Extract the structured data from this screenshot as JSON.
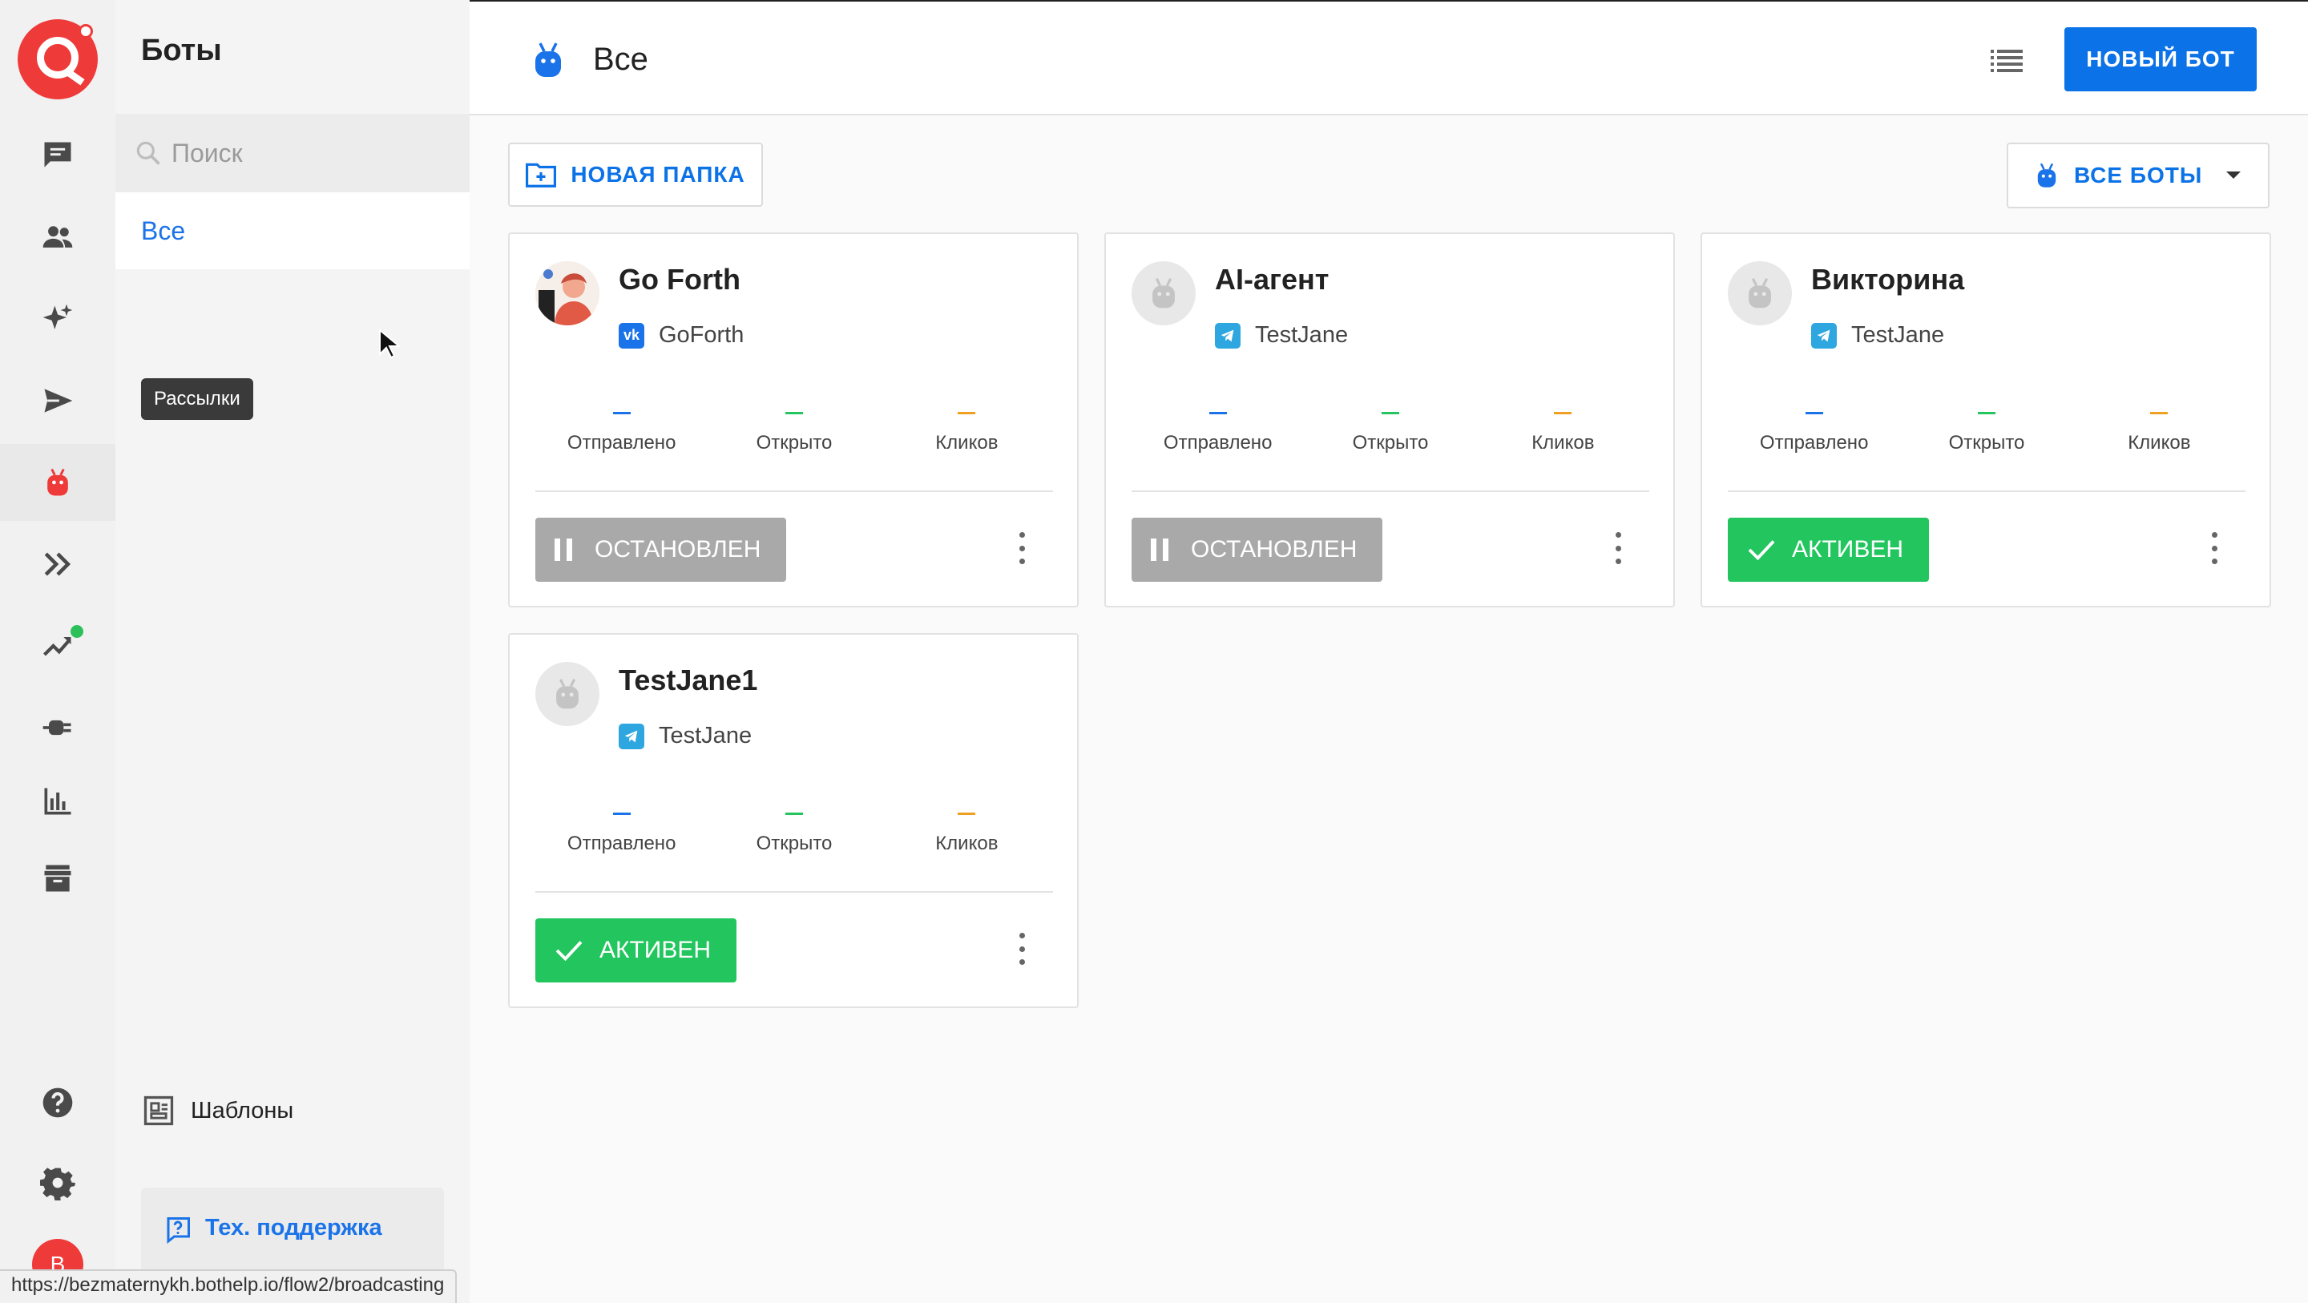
{
  "sidebar": {
    "title": "Боты",
    "search_placeholder": "Поиск",
    "folder_all": "Все",
    "templates_label": "Шаблоны",
    "support_label": "Тех. поддержка"
  },
  "rail": {
    "avatar_letter": "B",
    "tooltip": "Рассылки"
  },
  "header": {
    "title": "Все",
    "new_bot_label": "НОВЫЙ БОТ"
  },
  "toolbar": {
    "new_folder_label": "НОВАЯ ПАПКА",
    "filter_label": "ВСЕ БОТЫ"
  },
  "cards": [
    {
      "name": "Go Forth",
      "channel": "GoForth",
      "channel_type": "vk",
      "sent": "–",
      "opened": "–",
      "clicks": "–",
      "status": "ОСТАНОВЛЕН",
      "state": "stopped"
    },
    {
      "name": "AI-агент",
      "channel": "TestJane",
      "channel_type": "telegram",
      "sent": "–",
      "opened": "–",
      "clicks": "–",
      "status": "ОСТАНОВЛЕН",
      "state": "stopped"
    },
    {
      "name": "Викторина",
      "channel": "TestJane",
      "channel_type": "telegram",
      "sent": "–",
      "opened": "–",
      "clicks": "–",
      "status": "АКТИВЕН",
      "state": "active"
    },
    {
      "name": "TestJane1",
      "channel": "TestJane",
      "channel_type": "telegram",
      "sent": "–",
      "opened": "–",
      "clicks": "–",
      "status": "АКТИВЕН",
      "state": "active"
    }
  ],
  "stat_labels": {
    "sent": "Отправлено",
    "opened": "Открыто",
    "clicks": "Кликов"
  },
  "colors": {
    "accent": "#0b72e7",
    "brand": "#ef3a3a",
    "active": "#22c55e",
    "stopped": "#a9a9a9",
    "sent_dash": "#1a73e8",
    "opened_dash": "#22c55e",
    "clicks_dash": "#f0a020"
  },
  "status_bar": {
    "url": "https://bezmaternykh.bothelp.io/flow2/broadcasting"
  }
}
